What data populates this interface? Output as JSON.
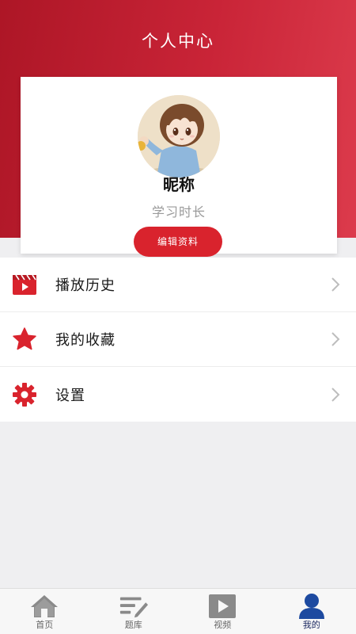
{
  "header": {
    "title": "个人中心"
  },
  "profile": {
    "nickname": "昵称",
    "study_time": "学习时长",
    "edit_button": "编辑资料"
  },
  "menu": {
    "items": [
      {
        "label": "播放历史",
        "icon": "play-history-icon"
      },
      {
        "label": "我的收藏",
        "icon": "star-icon"
      },
      {
        "label": "设置",
        "icon": "gear-icon"
      }
    ]
  },
  "tabbar": {
    "tabs": [
      {
        "label": "首页",
        "icon": "home-icon"
      },
      {
        "label": "题库",
        "icon": "question-bank-icon"
      },
      {
        "label": "视频",
        "icon": "video-icon"
      },
      {
        "label": "我的",
        "icon": "user-icon",
        "active": true
      }
    ]
  },
  "colors": {
    "header_gradient_start": "#ad1626",
    "header_gradient_end": "#dc3b4c",
    "accent_red": "#d9232d",
    "active_tab": "#1d4aa0",
    "inactive_tab": "#8a8a8a"
  }
}
